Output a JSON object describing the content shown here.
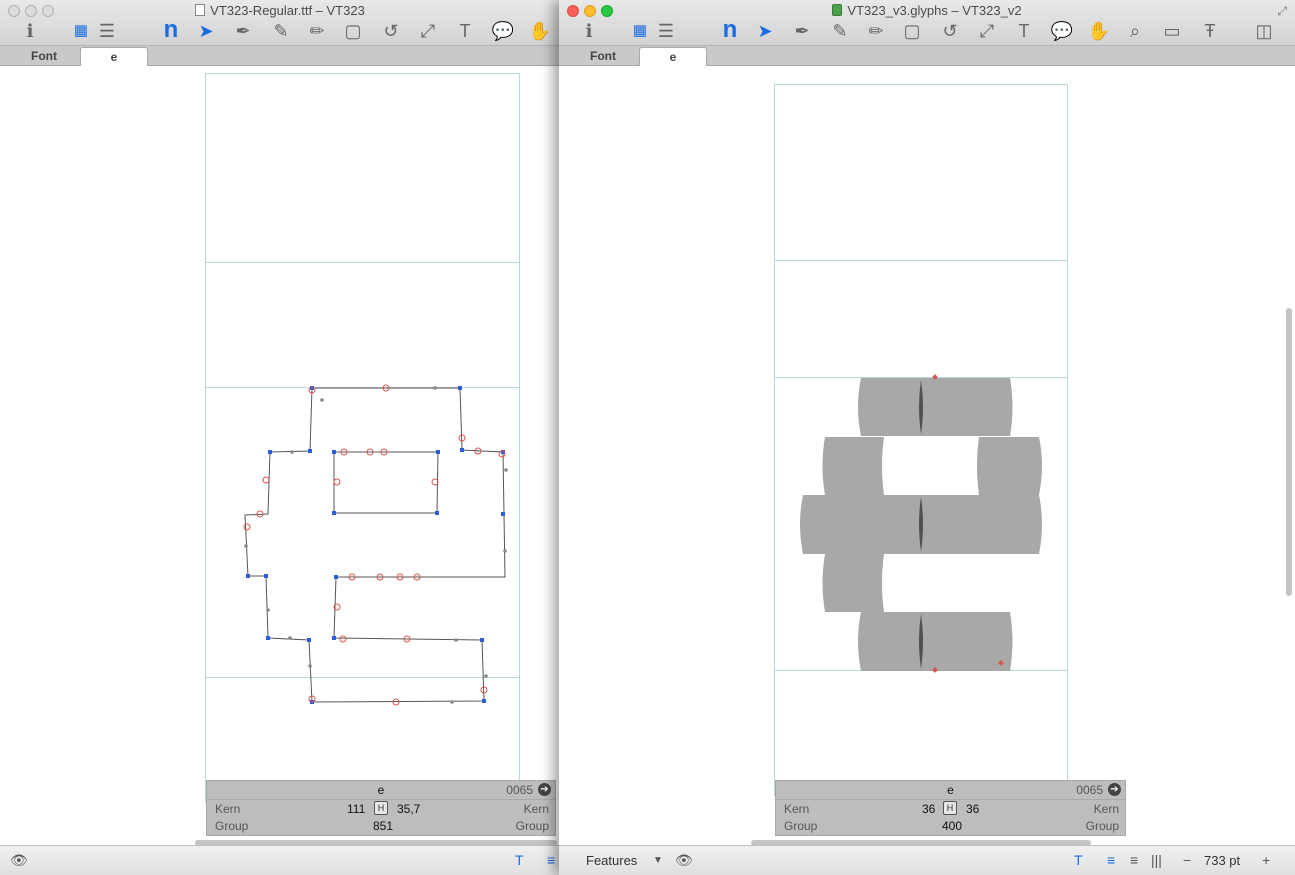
{
  "left_window": {
    "title": "VT323-Regular.ttf – VT323",
    "tabs": [
      {
        "label": "Font"
      },
      {
        "label": "e"
      }
    ],
    "info": {
      "glyph_name": "e",
      "unicode": "0065",
      "kern_label_left": "Kern",
      "kern_label_right": "Kern",
      "kern_left": "111",
      "kern_right": "35,7",
      "group_label_left": "Group",
      "group_label_right": "Group",
      "width": "851"
    }
  },
  "right_window": {
    "title": "VT323_v3.glyphs – VT323_v2",
    "tabs": [
      {
        "label": "Font"
      },
      {
        "label": "e"
      }
    ],
    "info": {
      "glyph_name": "e",
      "unicode": "0065",
      "kern_label_left": "Kern",
      "kern_label_right": "Kern",
      "kern_left": "36",
      "kern_right": "36",
      "group_label_left": "Group",
      "group_label_right": "Group",
      "width": "400"
    },
    "status": {
      "features_label": "Features",
      "zoom": "733 pt"
    }
  },
  "toolbar_icons": [
    "info-icon",
    "grid-view-icon",
    "list-view-icon",
    "n-preview-icon",
    "select-tool-icon",
    "draw-tool-icon",
    "pen-tool-icon",
    "pencil-tool-icon",
    "rectangle-tool-icon",
    "rotate-tool-icon",
    "scale-tool-icon",
    "text-tool-icon",
    "annotation-tool-icon",
    "hand-tool-icon",
    "zoom-tool-icon",
    "measure-tool-icon",
    "sidebearing-tool-icon",
    "sidebar-toggle-icon"
  ],
  "colors": {
    "guide": "#b8d8dc",
    "glyph_fill": "#a8a8a8",
    "node_blue": "#2b5fd6",
    "node_red": "#d9534f",
    "accent": "#1a6de0"
  }
}
